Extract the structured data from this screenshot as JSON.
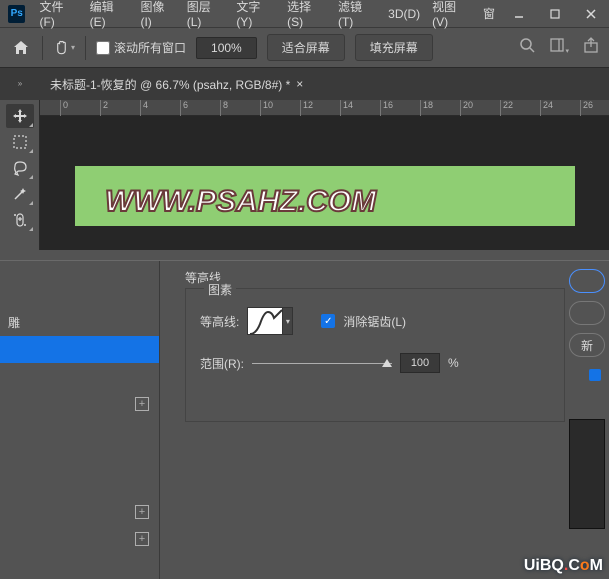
{
  "menu": {
    "file": "文件(F)",
    "edit": "编辑(E)",
    "image": "图像(I)",
    "layer": "图层(L)",
    "type": "文字(Y)",
    "select": "选择(S)",
    "filter": "滤镜(T)",
    "threeD": "3D(D)",
    "view": "视图(V)",
    "window": "窗"
  },
  "options": {
    "scroll_all_windows_label": "滚动所有窗口",
    "zoom_value": "100%",
    "fit_screen_label": "适合屏幕",
    "fill_screen_label": "填充屏幕"
  },
  "tab": {
    "title": "未标题-1-恢复的 @ 66.7% (psahz, RGB/8#) *"
  },
  "ruler_ticks": [
    "0",
    "2",
    "4",
    "6",
    "8",
    "10",
    "12",
    "14",
    "16",
    "18",
    "20",
    "22",
    "24",
    "26"
  ],
  "canvas": {
    "text": "WWW.PSAHZ.COM"
  },
  "layerstyle": {
    "sidebar_item_highlight": "雕",
    "contour_group_title": "等高线",
    "contour_subtitle": "图素",
    "contour_label": "等高线:",
    "antialias_label": "消除锯齿(L)",
    "range_label": "范围(R):",
    "range_value": "100",
    "range_unit": "%",
    "new_button": "新"
  },
  "watermark": "UiBQ.CoM"
}
